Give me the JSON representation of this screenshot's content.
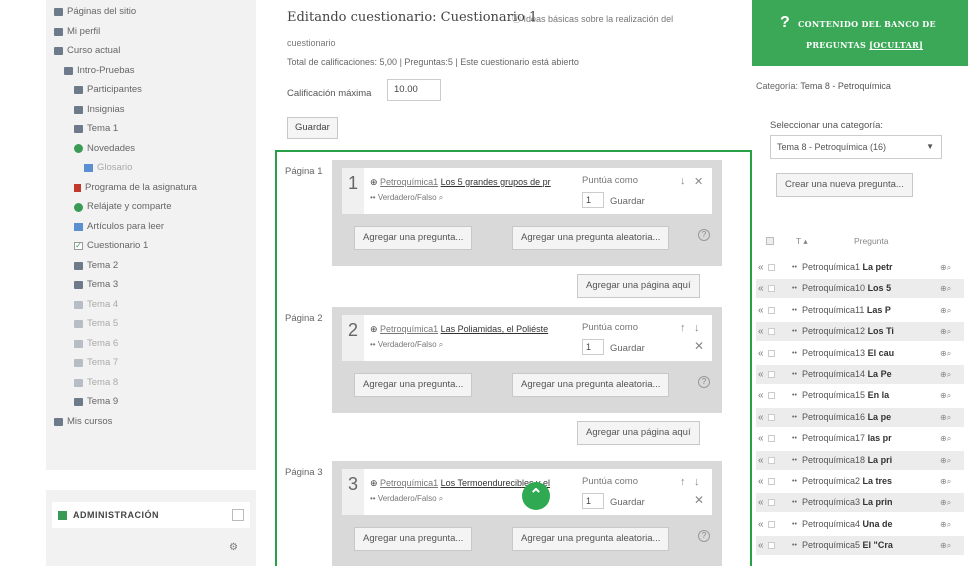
{
  "nav": {
    "items": [
      {
        "label": "Páginas del sitio",
        "icon": "folder-icon",
        "indent": 0,
        "faded": false
      },
      {
        "label": "Mi perfil",
        "icon": "folder-icon",
        "indent": 0,
        "faded": false
      },
      {
        "label": "Curso actual",
        "icon": "folder-icon",
        "indent": 0,
        "faded": false
      },
      {
        "label": "Intro-Pruebas",
        "icon": "folder-icon",
        "indent": 1,
        "faded": false
      },
      {
        "label": "Participantes",
        "icon": "folder-icon",
        "indent": 2,
        "faded": false
      },
      {
        "label": "Insignias",
        "icon": "folder-icon",
        "indent": 2,
        "faded": false
      },
      {
        "label": "Tema 1",
        "icon": "folder-icon",
        "indent": 2,
        "faded": false
      },
      {
        "label": "Novedades",
        "icon": "forum-icon",
        "indent": 2,
        "faded": false
      },
      {
        "label": "Glosario",
        "icon": "glossary-icon",
        "indent": 3,
        "faded": true
      },
      {
        "label": "Programa de la asignatura",
        "icon": "page-icon",
        "indent": 2,
        "faded": false
      },
      {
        "label": "Relájate y comparte",
        "icon": "forum-icon",
        "indent": 2,
        "faded": false
      },
      {
        "label": "Artículos para leer",
        "icon": "document-icon",
        "indent": 2,
        "faded": false
      },
      {
        "label": "Cuestionario 1",
        "icon": "quiz-icon",
        "indent": 2,
        "faded": false
      },
      {
        "label": "Tema 2",
        "icon": "folder-icon",
        "indent": 2,
        "faded": false
      },
      {
        "label": "Tema 3",
        "icon": "folder-icon",
        "indent": 2,
        "faded": false
      },
      {
        "label": "Tema 4",
        "icon": "folder-icon",
        "indent": 2,
        "faded": true
      },
      {
        "label": "Tema 5",
        "icon": "folder-icon",
        "indent": 2,
        "faded": true
      },
      {
        "label": "Tema 6",
        "icon": "folder-icon",
        "indent": 2,
        "faded": true
      },
      {
        "label": "Tema 7",
        "icon": "folder-icon",
        "indent": 2,
        "faded": true
      },
      {
        "label": "Tema 8",
        "icon": "folder-icon",
        "indent": 2,
        "faded": true
      },
      {
        "label": "Tema 9",
        "icon": "folder-icon",
        "indent": 2,
        "faded": false
      },
      {
        "label": "Mis cursos",
        "icon": "folder-icon",
        "indent": 0,
        "faded": false
      }
    ]
  },
  "admin": {
    "title": "ADMINISTRACIÓN",
    "gear_icon": "gear-icon"
  },
  "main": {
    "heading": "Editando cuestionario: Cuestionario 1",
    "help_link": "Ideas básicas sobre la realización del",
    "help_link_cont": "cuestionario",
    "totals": "Total de calificaciones: 5,00 | Preguntas:5 | Este cuestionario está abierto",
    "max_grade_label": "Calificación máxima",
    "max_grade_value": "10.00",
    "save_label": "Guardar",
    "scroll_top_icon": "chevron-up-icon"
  },
  "slots": [
    {
      "page_label": "Página 1",
      "number": "1",
      "category": "Petroquímica1",
      "question": "Los 5 grandes grupos de pr",
      "type": "Verdadero/Falso",
      "points_label": "Puntúa como",
      "points": "1",
      "points_save": "Guardar",
      "add_question": "Agregar una pregunta...",
      "add_random": "Agregar una pregunta aleatoria...",
      "add_page": "Agregar una página aquí",
      "move_icons": "↓ ✕"
    },
    {
      "page_label": "Página 2",
      "number": "2",
      "category": "Petroquímica1",
      "question": "Las Poliamidas, el Poliéste",
      "type": "Verdadero/Falso",
      "points_label": "Puntúa como",
      "points": "1",
      "points_save": "Guardar",
      "add_question": "Agregar una pregunta...",
      "add_random": "Agregar una pregunta aleatoria...",
      "add_page": "Agregar una página aquí",
      "move_icons": "↑ ↓"
    },
    {
      "page_label": "Página 3",
      "number": "3",
      "category": "Petroquímica1",
      "question": "Los Termoendurecibles y el",
      "type": "Verdadero/Falso",
      "points_label": "Puntúa como",
      "points": "1",
      "points_save": "Guardar",
      "add_question": "Agregar una pregunta...",
      "add_random": "Agregar una pregunta aleatoria...",
      "add_page": "",
      "move_icons": "↑ ↓"
    }
  ],
  "bank": {
    "header_title": "CONTENIDO DEL BANCO DE",
    "header_title2": "PREGUNTAS",
    "header_hide": "[OCULTAR]",
    "category_label": "Categoría:",
    "category_value": "Tema 8 - Petroquímica",
    "select_label": "Seleccionar una categoría:",
    "select_value": "Tema 8 - Petroquímica (16)",
    "new_question": "Crear una nueva pregunta...",
    "col_type": "T",
    "col_question": "Pregunta",
    "rows": [
      {
        "name": "Petroquímica1",
        "text": "La petr"
      },
      {
        "name": "Petroquímica10",
        "text": "Los 5"
      },
      {
        "name": "Petroquímica11",
        "text": "Las P"
      },
      {
        "name": "Petroquímica12",
        "text": "Los Ti"
      },
      {
        "name": "Petroquímica13",
        "text": "El cau"
      },
      {
        "name": "Petroquímica14",
        "text": "La Pe"
      },
      {
        "name": "Petroquímica15",
        "text": "En la"
      },
      {
        "name": "Petroquímica16",
        "text": "La pe"
      },
      {
        "name": "Petroquímica17",
        "text": "las pr"
      },
      {
        "name": "Petroquímica18",
        "text": "La pri"
      },
      {
        "name": "Petroquímica2",
        "text": "La tres"
      },
      {
        "name": "Petroquímica3",
        "text": "La prin"
      },
      {
        "name": "Petroquímica4",
        "text": "Una de"
      },
      {
        "name": "Petroquímica5",
        "text": "El \"Cra"
      }
    ]
  }
}
